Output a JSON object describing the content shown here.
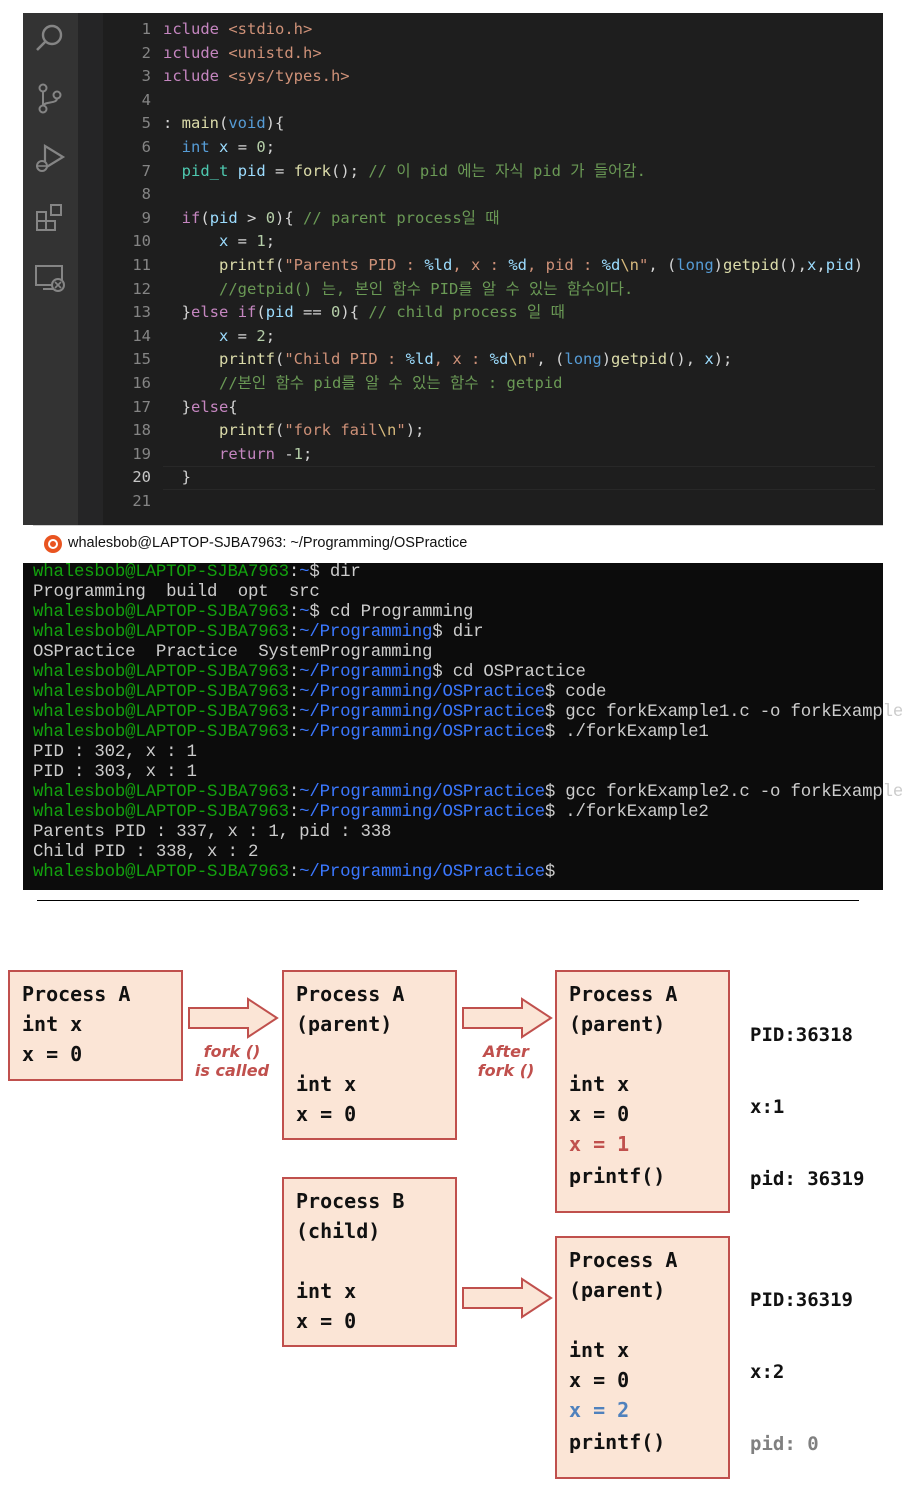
{
  "editor": {
    "activity_icons": [
      "search-icon",
      "source-control-icon",
      "run-debug-icon",
      "extensions-icon",
      "remote-explorer-icon"
    ],
    "active_line": "20",
    "lines": [
      {
        "n": "1",
        "t": [
          [
            "pp",
            "ıclude "
          ],
          [
            "str",
            "<stdio.h>"
          ]
        ]
      },
      {
        "n": "2",
        "t": [
          [
            "pp",
            "ıclude "
          ],
          [
            "str",
            "<unistd.h>"
          ]
        ]
      },
      {
        "n": "3",
        "t": [
          [
            "pp",
            "ıclude "
          ],
          [
            "str",
            "<sys/types.h>"
          ]
        ]
      },
      {
        "n": "4",
        "t": []
      },
      {
        "n": "5",
        "t": [
          [
            "pl",
            ": "
          ],
          [
            "fn",
            "main"
          ],
          [
            "pl",
            "("
          ],
          [
            "kw",
            "void"
          ],
          [
            "pl",
            "){"
          ]
        ]
      },
      {
        "n": "6",
        "t": [
          [
            "pl",
            "  "
          ],
          [
            "kw",
            "int"
          ],
          [
            "pl",
            " "
          ],
          [
            "var",
            "x"
          ],
          [
            "pl",
            " = "
          ],
          [
            "num",
            "0"
          ],
          [
            "pl",
            ";"
          ]
        ]
      },
      {
        "n": "7",
        "t": [
          [
            "pl",
            "  "
          ],
          [
            "ty",
            "pid_t"
          ],
          [
            "pl",
            " "
          ],
          [
            "var",
            "pid"
          ],
          [
            "pl",
            " = "
          ],
          [
            "fn",
            "fork"
          ],
          [
            "pl",
            "(); "
          ],
          [
            "cmt",
            "// 이 pid 에는 자식 pid 가 들어감."
          ]
        ]
      },
      {
        "n": "8",
        "t": []
      },
      {
        "n": "9",
        "t": [
          [
            "pl",
            "  "
          ],
          [
            "ctl",
            "if"
          ],
          [
            "pl",
            "("
          ],
          [
            "var",
            "pid"
          ],
          [
            "pl",
            " > "
          ],
          [
            "num",
            "0"
          ],
          [
            "pl",
            "){ "
          ],
          [
            "cmt",
            "// parent process일 때"
          ]
        ]
      },
      {
        "n": "10",
        "t": [
          [
            "pl",
            "      "
          ],
          [
            "var",
            "x"
          ],
          [
            "pl",
            " = "
          ],
          [
            "num",
            "1"
          ],
          [
            "pl",
            ";"
          ]
        ]
      },
      {
        "n": "11",
        "t": [
          [
            "pl",
            "      "
          ],
          [
            "fn",
            "printf"
          ],
          [
            "pl",
            "("
          ],
          [
            "str",
            "\"Parents PID : "
          ],
          [
            "var",
            "%ld"
          ],
          [
            "str",
            ", x : "
          ],
          [
            "var",
            "%d"
          ],
          [
            "str",
            ", pid : "
          ],
          [
            "var",
            "%d"
          ],
          [
            "esc",
            "\\n"
          ],
          [
            "str",
            "\""
          ],
          [
            "pl",
            ", ("
          ],
          [
            "kw",
            "long"
          ],
          [
            "pl",
            ")"
          ],
          [
            "fn",
            "getpid"
          ],
          [
            "pl",
            "(),"
          ],
          [
            "var",
            "x"
          ],
          [
            "pl",
            ","
          ],
          [
            "var",
            "pid"
          ],
          [
            "pl",
            ")"
          ]
        ]
      },
      {
        "n": "12",
        "t": [
          [
            "pl",
            "      "
          ],
          [
            "cmt",
            "//getpid() 는, 본인 함수 PID를 알 수 있는 함수이다."
          ]
        ]
      },
      {
        "n": "13",
        "t": [
          [
            "pl",
            "  "
          ],
          [
            "pl",
            "}"
          ],
          [
            "ctl",
            "else"
          ],
          [
            "pl",
            " "
          ],
          [
            "ctl",
            "if"
          ],
          [
            "pl",
            "("
          ],
          [
            "var",
            "pid"
          ],
          [
            "pl",
            " == "
          ],
          [
            "num",
            "0"
          ],
          [
            "pl",
            "){ "
          ],
          [
            "cmt",
            "// child process 일 때"
          ]
        ]
      },
      {
        "n": "14",
        "t": [
          [
            "pl",
            "      "
          ],
          [
            "var",
            "x"
          ],
          [
            "pl",
            " = "
          ],
          [
            "num",
            "2"
          ],
          [
            "pl",
            ";"
          ]
        ]
      },
      {
        "n": "15",
        "t": [
          [
            "pl",
            "      "
          ],
          [
            "fn",
            "printf"
          ],
          [
            "pl",
            "("
          ],
          [
            "str",
            "\"Child PID : "
          ],
          [
            "var",
            "%ld"
          ],
          [
            "str",
            ", x : "
          ],
          [
            "var",
            "%d"
          ],
          [
            "esc",
            "\\n"
          ],
          [
            "str",
            "\""
          ],
          [
            "pl",
            ", ("
          ],
          [
            "kw",
            "long"
          ],
          [
            "pl",
            ")"
          ],
          [
            "fn",
            "getpid"
          ],
          [
            "pl",
            "(), "
          ],
          [
            "var",
            "x"
          ],
          [
            "pl",
            ");"
          ]
        ]
      },
      {
        "n": "16",
        "t": [
          [
            "pl",
            "      "
          ],
          [
            "cmt",
            "//본인 함수 pid를 알 수 있는 함수 : getpid"
          ]
        ]
      },
      {
        "n": "17",
        "t": [
          [
            "pl",
            "  "
          ],
          [
            "pl",
            "}"
          ],
          [
            "ctl",
            "else"
          ],
          [
            "pl",
            "{"
          ]
        ]
      },
      {
        "n": "18",
        "t": [
          [
            "pl",
            "      "
          ],
          [
            "fn",
            "printf"
          ],
          [
            "pl",
            "("
          ],
          [
            "str",
            "\"fork fail"
          ],
          [
            "esc",
            "\\n"
          ],
          [
            "str",
            "\""
          ],
          [
            "pl",
            ");"
          ]
        ]
      },
      {
        "n": "19",
        "t": [
          [
            "pl",
            "      "
          ],
          [
            "ctl",
            "return"
          ],
          [
            "pl",
            " -"
          ],
          [
            "num",
            "1"
          ],
          [
            "pl",
            ";"
          ]
        ]
      },
      {
        "n": "20",
        "t": [
          [
            "pl",
            "  "
          ],
          [
            "pl",
            "}"
          ]
        ]
      },
      {
        "n": "21",
        "t": []
      }
    ]
  },
  "terminal": {
    "title": "whalesbob@LAPTOP-SJBA7963: ~/Programming/OSPractice",
    "lines": [
      {
        "u": "whalesbob@LAPTOP-SJBA7963",
        "p": "~",
        "c": "$ dir"
      },
      {
        "o": "Programming  build  opt  src"
      },
      {
        "u": "whalesbob@LAPTOP-SJBA7963",
        "p": "~",
        "c": "$ cd Programming"
      },
      {
        "u": "whalesbob@LAPTOP-SJBA7963",
        "p": "~/Programming",
        "c": "$ dir"
      },
      {
        "o": "OSPractice  Practice  SystemProgramming"
      },
      {
        "u": "whalesbob@LAPTOP-SJBA7963",
        "p": "~/Programming",
        "c": "$ cd OSPractice"
      },
      {
        "u": "whalesbob@LAPTOP-SJBA7963",
        "p": "~/Programming/OSPractice",
        "c": "$ code"
      },
      {
        "u": "whalesbob@LAPTOP-SJBA7963",
        "p": "~/Programming/OSPractice",
        "c": "$ gcc forkExample1.c -o forkExample"
      },
      {
        "u": "whalesbob@LAPTOP-SJBA7963",
        "p": "~/Programming/OSPractice",
        "c": "$ ./forkExample1"
      },
      {
        "o": "PID : 302, x : 1"
      },
      {
        "o": "PID : 303, x : 1"
      },
      {
        "u": "whalesbob@LAPTOP-SJBA7963",
        "p": "~/Programming/OSPractice",
        "c": "$ gcc forkExample2.c -o forkExample"
      },
      {
        "u": "whalesbob@LAPTOP-SJBA7963",
        "p": "~/Programming/OSPractice",
        "c": "$ ./forkExample2"
      },
      {
        "o": "Parents PID : 337, x : 1, pid : 338"
      },
      {
        "o": "Child PID : 338, x : 2"
      },
      {
        "u": "whalesbob@LAPTOP-SJBA7963",
        "p": "~/Programming/OSPractice",
        "c": "$"
      }
    ]
  },
  "diagram": {
    "box_a": [
      "Process A",
      "int x",
      "x = 0"
    ],
    "label_fork_called": [
      "fork ()",
      "is called"
    ],
    "box_parent": [
      "Process A",
      "(parent)",
      "",
      "int x",
      "x = 0"
    ],
    "label_after_fork": [
      "After",
      "fork ()"
    ],
    "box_child": [
      "Process B",
      "(child)",
      "",
      "int x",
      "x = 0"
    ],
    "box_parent_after": [
      "Process A",
      "(parent)",
      "",
      "int x",
      "x = 0",
      "x = 1",
      "printf()"
    ],
    "box_child_after": [
      "Process A",
      "(parent)",
      "",
      "int x",
      "x = 0",
      "x = 2",
      "printf()"
    ],
    "note_parent": [
      "PID:36318",
      "x:1",
      "pid: 36319"
    ],
    "note_child": [
      "PID:36319",
      "x:2",
      "pid: 0"
    ],
    "colors": {
      "box_fill": "#fbe5d6",
      "box_border": "#c0504d",
      "changed_parent": "#c0504d",
      "changed_child": "#4f81bd",
      "muted": "#808080"
    }
  }
}
